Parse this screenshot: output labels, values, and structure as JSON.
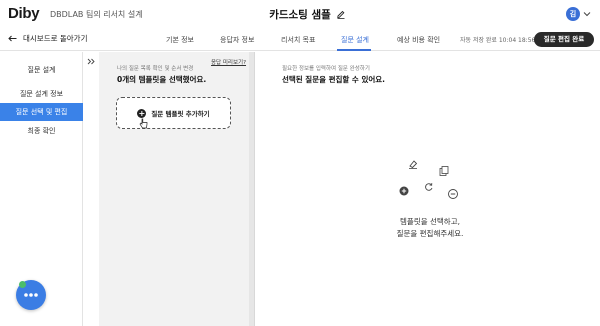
{
  "header": {
    "logo": "Diby",
    "team": "DBDLAB 팀의 리서치 설계",
    "title": "카드소팅 샘플",
    "avatar_initial": "김"
  },
  "nav": {
    "back_label": "대시보드로 돌아가기",
    "tabs": [
      {
        "label": "기본 정보",
        "active": false
      },
      {
        "label": "응답자 정보",
        "active": false
      },
      {
        "label": "리서치 목표",
        "active": false
      },
      {
        "label": "질문 설계",
        "active": true
      },
      {
        "label": "예상 비용 확인",
        "active": false
      }
    ],
    "autosave": "자동 저장 완료 10:04 18:56",
    "finish_button": "질문 편집 완료"
  },
  "sidebar": {
    "items": [
      {
        "label": "질문 설계",
        "active": false
      },
      {
        "label": "질문 설계 정보",
        "active": false
      },
      {
        "label": "질문 선택 및 편집",
        "active": true
      },
      {
        "label": "최종 확인",
        "active": false
      }
    ]
  },
  "middle": {
    "subtitle": "나의 질문 목록 확인 및 순서 변경",
    "title": "0개의 템플릿을 선택했어요.",
    "help_link": "응답 미리보기?",
    "add_template": "질문 템플릿 추가하기"
  },
  "right": {
    "subtitle": "필요한 정보를 입력하여 질문 완성하기",
    "title": "선택된 질문을 편집할 수 있어요.",
    "empty_line1": "템플릿을 선택하고,",
    "empty_line2": "질문을 편집해주세요."
  },
  "colors": {
    "accent": "#3a6fd6",
    "sidebar_active": "#3a82e8",
    "dark_button": "#2a2a2a",
    "chat_fab": "#3b7de4"
  }
}
